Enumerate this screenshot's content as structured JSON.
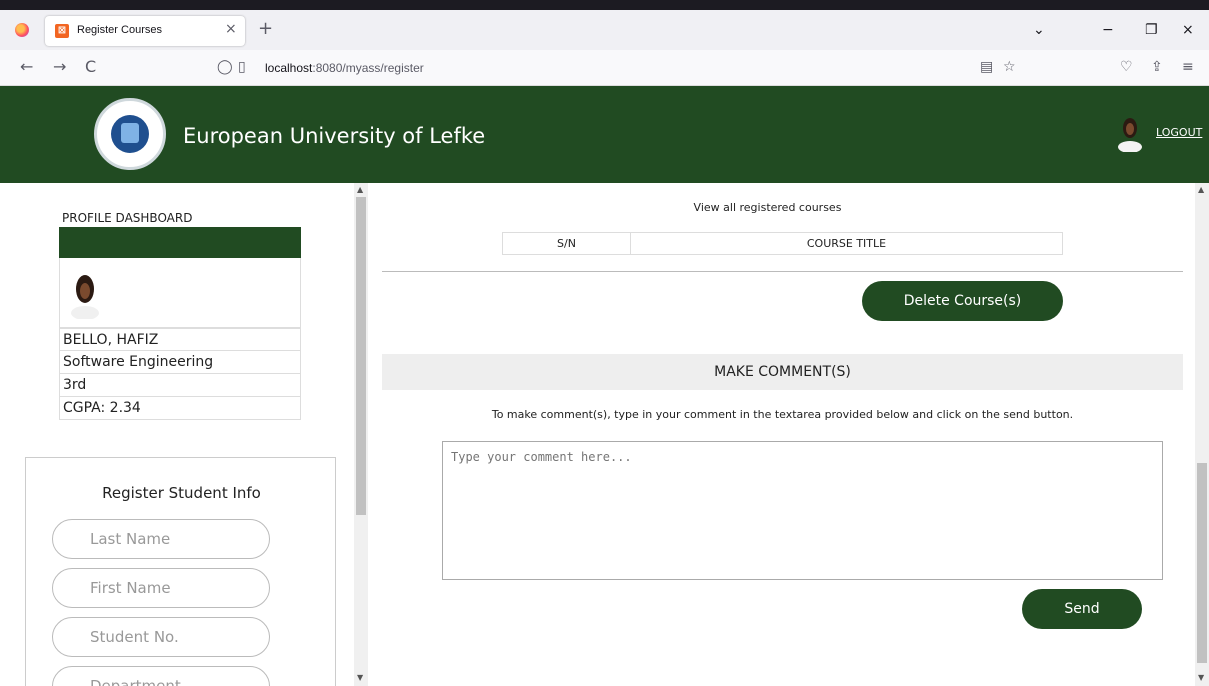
{
  "browser": {
    "tab_title": "Register Courses",
    "tab_close": "×",
    "new_tab": "+",
    "url_host": "localhost",
    "url_path": ":8080/myass/register",
    "back": "←",
    "forward": "→",
    "reload": "C",
    "min": "−",
    "restore": "❐",
    "close": "×",
    "list_all_tabs": "⌄",
    "reader": "▤",
    "star": "☆",
    "pocket": "♡",
    "share": "⇪",
    "menu": "≡"
  },
  "header": {
    "title": "European University of Lefke",
    "logout": "LOGOUT"
  },
  "profile": {
    "label": "PROFILE DASHBOARD",
    "name": "BELLO, HAFIZ",
    "department": "Software Engineering",
    "level": "3rd",
    "cgpa": "CGPA: 2.34"
  },
  "register_form": {
    "title": "Register Student Info",
    "fields": [
      "Last Name",
      "First Name",
      "Student No.",
      "Department"
    ]
  },
  "courses": {
    "view_label": "View all registered courses",
    "columns": [
      "S/N",
      "COURSE TITLE"
    ],
    "delete_label": "Delete Course(s)"
  },
  "comment": {
    "heading": "MAKE COMMENT(S)",
    "info": "To make comment(s), type in your comment in the textarea provided below and click on the send button.",
    "placeholder": "Type your comment here...",
    "send_label": "Send"
  },
  "colors": {
    "brand_green": "#214b22"
  }
}
